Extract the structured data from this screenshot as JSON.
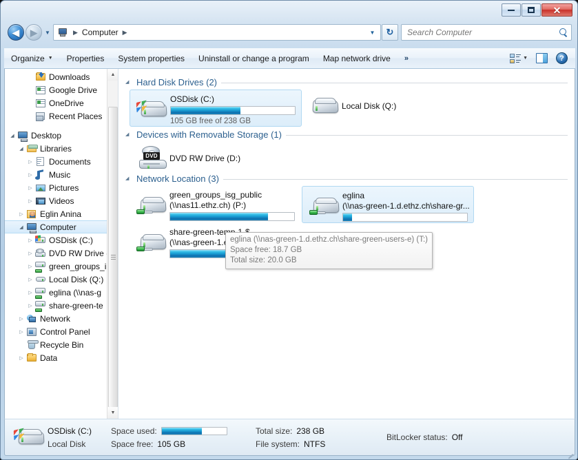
{
  "window": {
    "caption_buttons": {
      "minimize": "minimize",
      "maximize": "maximize",
      "close": "✕"
    }
  },
  "nav": {
    "back_arrow": "◀",
    "forward_arrow": "▶",
    "history_caret": "▼",
    "breadcrumb_icon": "computer-icon",
    "breadcrumb": "Computer",
    "separator": "▶",
    "address_dropdown": "▼",
    "refresh_label": "↻",
    "search": {
      "placeholder": "Search Computer",
      "value": ""
    }
  },
  "toolbar": {
    "organize": "Organize",
    "organize_caret": "▼",
    "properties": "Properties",
    "system_properties": "System properties",
    "uninstall": "Uninstall or change a program",
    "map_network_drive": "Map network drive",
    "overflow": "»",
    "view_caret": "▼",
    "help": "?"
  },
  "sidebar": {
    "items": [
      {
        "label": "Downloads",
        "icon": "downloads-folder-icon",
        "indent": 2,
        "twisty": "none",
        "selected": false
      },
      {
        "label": "Google Drive",
        "icon": "google-drive-icon",
        "indent": 2,
        "twisty": "none",
        "selected": false
      },
      {
        "label": "OneDrive",
        "icon": "onedrive-icon",
        "indent": 2,
        "twisty": "none",
        "selected": false
      },
      {
        "label": "Recent Places",
        "icon": "recent-places-icon",
        "indent": 2,
        "twisty": "none",
        "selected": false
      },
      {
        "label": "",
        "icon": "spacer",
        "indent": 0,
        "twisty": "none",
        "selected": false
      },
      {
        "label": "Desktop",
        "icon": "desktop-icon",
        "indent": 0,
        "twisty": "open",
        "selected": false
      },
      {
        "label": "Libraries",
        "icon": "libraries-icon",
        "indent": 1,
        "twisty": "open",
        "selected": false
      },
      {
        "label": "Documents",
        "icon": "documents-icon",
        "indent": 2,
        "twisty": "closed",
        "selected": false
      },
      {
        "label": "Music",
        "icon": "music-icon",
        "indent": 2,
        "twisty": "closed",
        "selected": false
      },
      {
        "label": "Pictures",
        "icon": "pictures-icon",
        "indent": 2,
        "twisty": "closed",
        "selected": false
      },
      {
        "label": "Videos",
        "icon": "videos-icon",
        "indent": 2,
        "twisty": "closed",
        "selected": false
      },
      {
        "label": "Eglin  Anina",
        "icon": "user-folder-icon",
        "indent": 1,
        "twisty": "closed",
        "selected": false
      },
      {
        "label": "Computer",
        "icon": "computer-icon",
        "indent": 1,
        "twisty": "open",
        "selected": true
      },
      {
        "label": "OSDisk (C:)",
        "icon": "windows-drive-icon",
        "indent": 2,
        "twisty": "closed",
        "selected": false
      },
      {
        "label": "DVD RW Drive (",
        "icon": "dvd-drive-icon",
        "indent": 2,
        "twisty": "closed",
        "selected": false
      },
      {
        "label": "green_groups_i",
        "icon": "network-drive-icon",
        "indent": 2,
        "twisty": "closed",
        "selected": false
      },
      {
        "label": "Local Disk (Q:)",
        "icon": "local-disk-icon",
        "indent": 2,
        "twisty": "closed",
        "selected": false
      },
      {
        "label": "eglina (\\\\nas-g",
        "icon": "network-drive-icon",
        "indent": 2,
        "twisty": "closed",
        "selected": false
      },
      {
        "label": "share-green-te",
        "icon": "network-drive-icon",
        "indent": 2,
        "twisty": "closed",
        "selected": false
      },
      {
        "label": "Network",
        "icon": "network-icon",
        "indent": 1,
        "twisty": "closed",
        "selected": false
      },
      {
        "label": "Control Panel",
        "icon": "control-panel-icon",
        "indent": 1,
        "twisty": "closed",
        "selected": false
      },
      {
        "label": "Recycle Bin",
        "icon": "recycle-bin-icon",
        "indent": 1,
        "twisty": "none",
        "selected": false
      },
      {
        "label": "Data",
        "icon": "folder-icon",
        "indent": 1,
        "twisty": "closed",
        "selected": false
      }
    ],
    "scroll_up": "▲",
    "scroll_down": "▼"
  },
  "content": {
    "groups": [
      {
        "title": "Hard Disk Drives (2)",
        "twisty": "▲",
        "items": [
          {
            "name": "OSDisk (C:)",
            "icon": "windows-hard-drive-icon",
            "selected": true,
            "has_bar": true,
            "bar_percent": 56,
            "sub": "105 GB free of 238 GB"
          },
          {
            "name": "Local Disk (Q:)",
            "icon": "hard-drive-icon",
            "selected": false,
            "has_bar": false,
            "bar_percent": 0,
            "sub": ""
          }
        ]
      },
      {
        "title": "Devices with Removable Storage (1)",
        "twisty": "▲",
        "items": [
          {
            "name": "DVD RW Drive (D:)",
            "icon": "dvd-drive-icon",
            "selected": false,
            "has_bar": false,
            "bar_percent": 0,
            "sub": "",
            "dvd_label": "DVD"
          }
        ]
      },
      {
        "title": "Network Location (3)",
        "twisty": "▲",
        "items": [
          {
            "name": "green_groups_isg_public",
            "name2": "(\\\\nas11.ethz.ch) (P:)",
            "icon": "network-drive-icon",
            "selected": false,
            "has_bar": true,
            "bar_percent": 79
          },
          {
            "name": "eglina",
            "name2": "(\\\\nas-green-1.d.ethz.ch\\share-gr...",
            "icon": "network-drive-icon",
            "selected": true,
            "has_bar": true,
            "bar_percent": 7
          },
          {
            "name": "share-green-temp-1-$",
            "name2": "(\\\\nas-green-1.ethz.ch) (X:)",
            "icon": "network-drive-icon",
            "selected": false,
            "has_bar": true,
            "bar_percent": 62
          }
        ]
      }
    ]
  },
  "tooltip": {
    "line1": "eglina (\\\\nas-green-1.d.ethz.ch\\share-green-users-e) (T:)",
    "line2": "Space free: 18.7 GB",
    "line3": "Total size: 20.0 GB"
  },
  "details": {
    "icon": "windows-hard-drive-icon",
    "name": "OSDisk (C:)",
    "type": "Local Disk",
    "space_used_label": "Space used:",
    "space_used_percent": 62,
    "space_free_label": "Space free:",
    "space_free_value": "105 GB",
    "total_size_label": "Total size:",
    "total_size_value": "238 GB",
    "file_system_label": "File system:",
    "file_system_value": "NTFS",
    "bitlocker_label": "BitLocker status:",
    "bitlocker_value": "Off"
  },
  "colors": {
    "accent_blue": "#1797cf",
    "group_header": "#2b5f8e",
    "selection": "#d6ebfb",
    "close_red": "#c9302a"
  }
}
